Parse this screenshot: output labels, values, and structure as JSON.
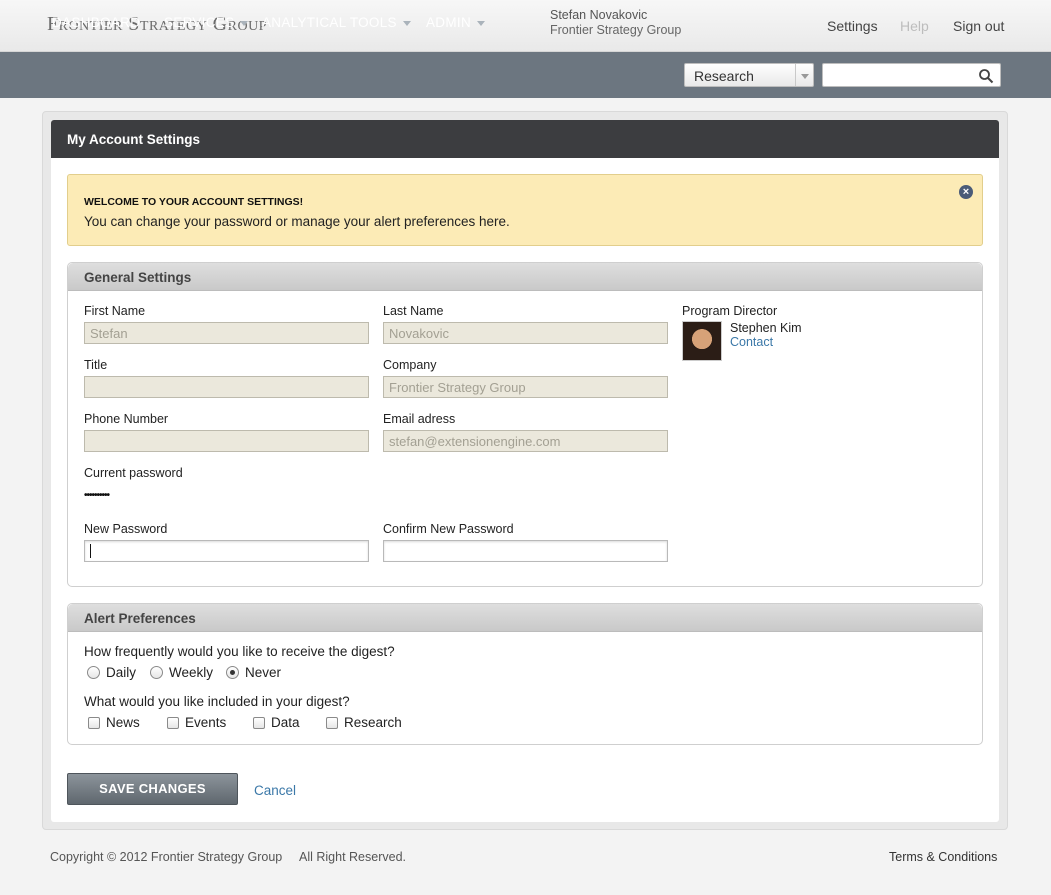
{
  "header": {
    "logo": "Frontier Strategy Group",
    "user_name": "Stefan Novakovic",
    "user_company": "Frontier Strategy Group",
    "links": {
      "settings": "Settings",
      "help": "Help",
      "signout": "Sign out"
    }
  },
  "nav": {
    "items": [
      {
        "label": "DASHBOARD",
        "has_menu": false
      },
      {
        "label": "SERVICES",
        "has_menu": true
      },
      {
        "label": "ANALYTICAL TOOLS",
        "has_menu": true
      },
      {
        "label": "ADMIN",
        "has_menu": true
      }
    ],
    "search_scope": "Research",
    "search_value": ""
  },
  "page": {
    "title": "My Account Settings",
    "welcome": {
      "heading": "WELCOME TO YOUR ACCOUNT SETTINGS!",
      "body": "You can change your password or manage your alert preferences here."
    }
  },
  "general": {
    "title": "General Settings",
    "first_name": {
      "label": "First Name",
      "value": "Stefan"
    },
    "last_name": {
      "label": "Last Name",
      "value": "Novakovic"
    },
    "title_field": {
      "label": "Title",
      "value": ""
    },
    "company": {
      "label": "Company",
      "value": "Frontier Strategy Group"
    },
    "phone": {
      "label": "Phone Number",
      "value": ""
    },
    "email": {
      "label": "Email adress",
      "value": "stefan@extensionengine.com"
    },
    "current_password": {
      "label": "Current password",
      "value": "••••••••••"
    },
    "new_password": {
      "label": "New Password",
      "value": ""
    },
    "confirm_password": {
      "label": "Confirm New Password",
      "value": ""
    },
    "program_director": {
      "label": "Program Director",
      "name": "Stephen Kim",
      "contact": "Contact"
    }
  },
  "alerts": {
    "title": "Alert Preferences",
    "frequency_question": "How frequently would you like to receive the digest?",
    "frequency_options": [
      "Daily",
      "Weekly",
      "Never"
    ],
    "frequency_selected": "Never",
    "include_question": "What would you like included in your digest?",
    "include_options": [
      "News",
      "Events",
      "Data",
      "Research"
    ]
  },
  "actions": {
    "save": "SAVE CHANGES",
    "cancel": "Cancel"
  },
  "footer": {
    "copyright": "Copyright © 2012 Frontier Strategy Group",
    "rights": "All Right Reserved.",
    "terms": "Terms & Conditions"
  }
}
